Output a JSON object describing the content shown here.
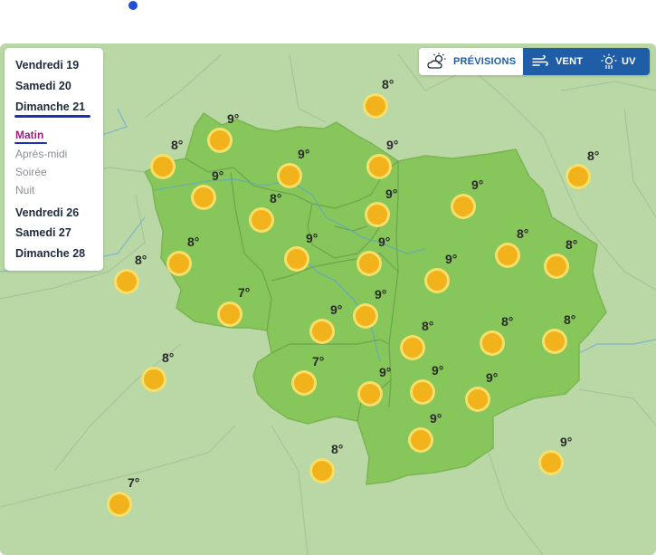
{
  "day_panel": {
    "items": [
      {
        "label": "Vendredi 19",
        "kind": "day"
      },
      {
        "label": "Samedi 20",
        "kind": "day"
      },
      {
        "label": "Dimanche 21",
        "kind": "day",
        "selected": true
      },
      {
        "label": "Matin",
        "kind": "period",
        "selected": true
      },
      {
        "label": "Après-midi",
        "kind": "period"
      },
      {
        "label": "Soirée",
        "kind": "period"
      },
      {
        "label": "Nuit",
        "kind": "period"
      },
      {
        "label": "Vendredi 26",
        "kind": "day"
      },
      {
        "label": "Samedi 27",
        "kind": "day"
      },
      {
        "label": "Dimanche 28",
        "kind": "day"
      }
    ]
  },
  "mode_bar": {
    "previsions": {
      "label": "PRÉVISIONS",
      "icon": "cloud-sun-icon"
    },
    "vent": {
      "label": "VENT",
      "icon": "wind-icon"
    },
    "uv": {
      "label": "UV",
      "icon": "uv-sun-icon"
    }
  },
  "map": {
    "weather_icon": "sun-icon",
    "colors": {
      "region": "#86c65a",
      "background": "#b9d8a6",
      "sun": "#f2b21c",
      "sun_ring": "#f7e06a",
      "accent": "#1f5ea6",
      "active_period": "#a11d7f"
    },
    "temperatures": [
      "8°",
      "9°",
      "9°",
      "8°",
      "9°",
      "8°",
      "9°",
      "8°",
      "9°",
      "9°",
      "9°",
      "8°",
      "9°",
      "8°",
      "8°",
      "9°",
      "8°",
      "7°",
      "9°",
      "9°",
      "8°",
      "8°",
      "8°",
      "8°",
      "7°",
      "9°",
      "9°",
      "9°",
      "9°",
      "8°",
      "9°",
      "7°"
    ]
  }
}
